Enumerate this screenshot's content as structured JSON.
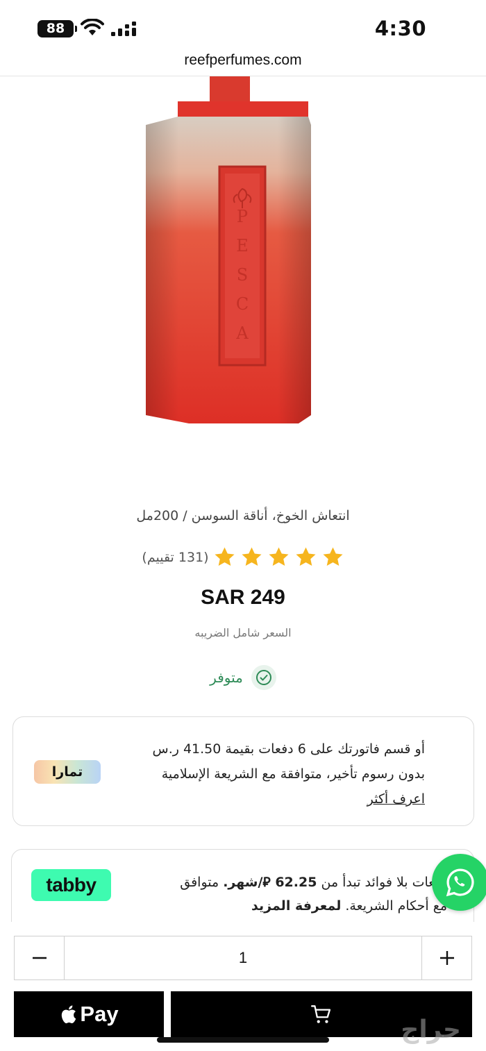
{
  "status_bar": {
    "battery": "88",
    "time": "4:30"
  },
  "browser": {
    "url": "reefperfumes.com"
  },
  "product": {
    "bottle_text": "PESCA",
    "title": "انتعاش الخوخ، أناقة السوسن / 200مل",
    "rating_stars": 5,
    "rating_count": "(131 تقييم)",
    "price": "SAR 249",
    "tax_note": "السعر شامل الضريبه",
    "stock_status": "متوفر"
  },
  "tamara": {
    "logo_text": "تمارا",
    "text": "أو قسم فاتورتك على 6 دفعات بقيمة 41.50 ر.س بدون رسوم تأخير، متوافقة مع الشريعة الإسلامية",
    "link": "اعرف أكثر"
  },
  "tabby": {
    "logo_text": "tabby",
    "text_line1_prefix": "دفعات بلا فوائد تبدأ من ",
    "amount": "62.25 ⃁/شهر.",
    "text_line1_suffix": " متوافق",
    "text_line2": "مع أحكام الشريعة.",
    "link": "لمعرفة المزيد"
  },
  "cart": {
    "quantity": "1",
    "apple_pay_label": "Pay"
  },
  "watermark": "حراج",
  "colors": {
    "accent_green": "#2e8b57",
    "star": "#f6b51e",
    "tabby_green": "#3efbb0",
    "whatsapp": "#25d366",
    "bottle_red": "#e0342c"
  }
}
